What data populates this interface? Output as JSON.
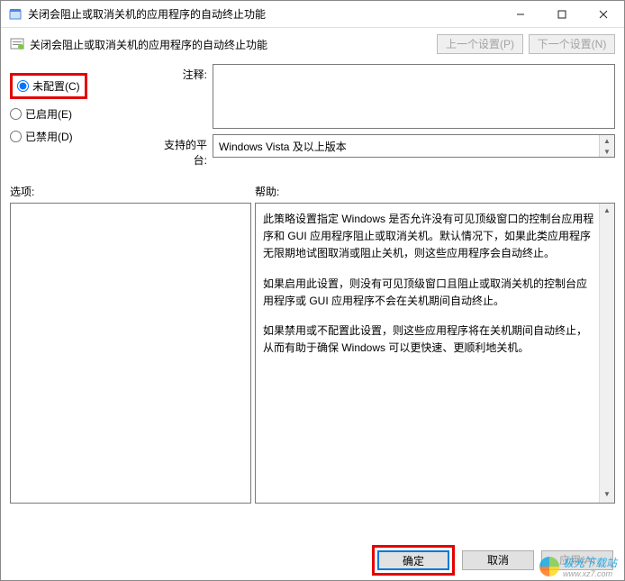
{
  "window": {
    "title": "关闭会阻止或取消关机的应用程序的自动终止功能",
    "minimize": "—",
    "close": "×"
  },
  "toolbar": {
    "title": "关闭会阻止或取消关机的应用程序的自动终止功能",
    "prev_label": "上一个设置(P)",
    "next_label": "下一个设置(N)"
  },
  "radio": {
    "not_configured": "未配置(C)",
    "enabled": "已启用(E)",
    "disabled": "已禁用(D)",
    "selected": "not_configured"
  },
  "form": {
    "comment_label": "注释:",
    "comment_value": "",
    "platform_label": "支持的平台:",
    "platform_value": "Windows Vista 及以上版本"
  },
  "sections": {
    "options_label": "选项:",
    "help_label": "帮助:"
  },
  "help": {
    "p1": "此策略设置指定 Windows 是否允许没有可见顶级窗口的控制台应用程序和 GUI 应用程序阻止或取消关机。默认情况下，如果此类应用程序无限期地试图取消或阻止关机，则这些应用程序会自动终止。",
    "p2": "如果启用此设置，则没有可见顶级窗口且阻止或取消关机的控制台应用程序或 GUI 应用程序不会在关机期间自动终止。",
    "p3": "如果禁用或不配置此设置，则这些应用程序将在关机期间自动终止，从而有助于确保 Windows 可以更快速、更顺利地关机。"
  },
  "footer": {
    "ok_label": "确定",
    "cancel_label": "取消",
    "apply_label": "应用(A)"
  },
  "watermark": {
    "text": "极光下载站",
    "sub": "www.xz7.com"
  }
}
